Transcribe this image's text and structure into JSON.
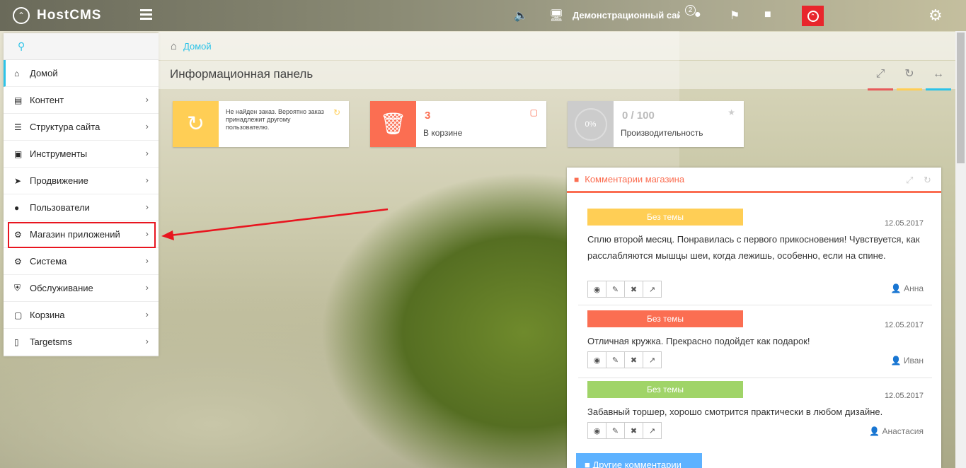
{
  "topbar": {
    "brand": "HostCMS",
    "site_name": "Демонстрационный сайт",
    "notifications_count": "2",
    "icons": [
      "volume-icon",
      "monitor-icon",
      "globe-icon",
      "flag-icon",
      "chat-icon",
      "alert-icon",
      "gear-icon"
    ]
  },
  "sidebar": {
    "items": [
      {
        "label": "Домой",
        "icon": "home-icon"
      },
      {
        "label": "Контент",
        "icon": "newspaper-icon"
      },
      {
        "label": "Структура сайта",
        "icon": "sitemap-icon"
      },
      {
        "label": "Инструменты",
        "icon": "briefcase-icon"
      },
      {
        "label": "Продвижение",
        "icon": "rocket-icon"
      },
      {
        "label": "Пользователи",
        "icon": "users-icon"
      },
      {
        "label": "Магазин приложений",
        "icon": "cogs-icon"
      },
      {
        "label": "Система",
        "icon": "gear-icon"
      },
      {
        "label": "Обслуживание",
        "icon": "shield-icon"
      },
      {
        "label": "Корзина",
        "icon": "trash-icon"
      },
      {
        "label": "Targetsms",
        "icon": "mobile-icon"
      }
    ]
  },
  "breadcrumb": {
    "home": "Домой"
  },
  "page": {
    "title": "Информационная панель"
  },
  "tiles": {
    "order": {
      "text": "Не найден заказ. Вероятно заказ принадлежит другому пользователю.",
      "color": "#ffce55"
    },
    "cart": {
      "count": "3",
      "label": "В корзине",
      "color": "#fb6e52"
    },
    "perf": {
      "percent": "0%",
      "value": "0 / 100",
      "label": "Производительность",
      "color": "#cccccc"
    }
  },
  "comments_widget": {
    "title": "Комментарии магазина",
    "more_label": "Другие комментарии",
    "comments": [
      {
        "tag": "Без темы",
        "tag_color": "#ffce55",
        "date": "12.05.2017",
        "text": "Сплю второй месяц. Понравилась с первого прикосновения! Чувствуется, как расслабляются мышцы шеи, когда лежишь, особенно, если на спине.",
        "author": "Анна"
      },
      {
        "tag": "Без темы",
        "tag_color": "#fb6e52",
        "date": "12.05.2017",
        "text": "Отличная кружка. Прекрасно подойдет как подарок!",
        "author": "Иван"
      },
      {
        "tag": "Без темы",
        "tag_color": "#a0d468",
        "date": "12.05.2017",
        "text": "Забавный торшер, хорошо смотрится практически в любом дизайне.",
        "author": "Анастасия"
      }
    ]
  },
  "colors": {
    "accent": "#2dc3e8",
    "highlight": "#e8151f",
    "red": "#e75b5b",
    "yellow": "#ffce55",
    "blue": "#2dc3e8"
  }
}
